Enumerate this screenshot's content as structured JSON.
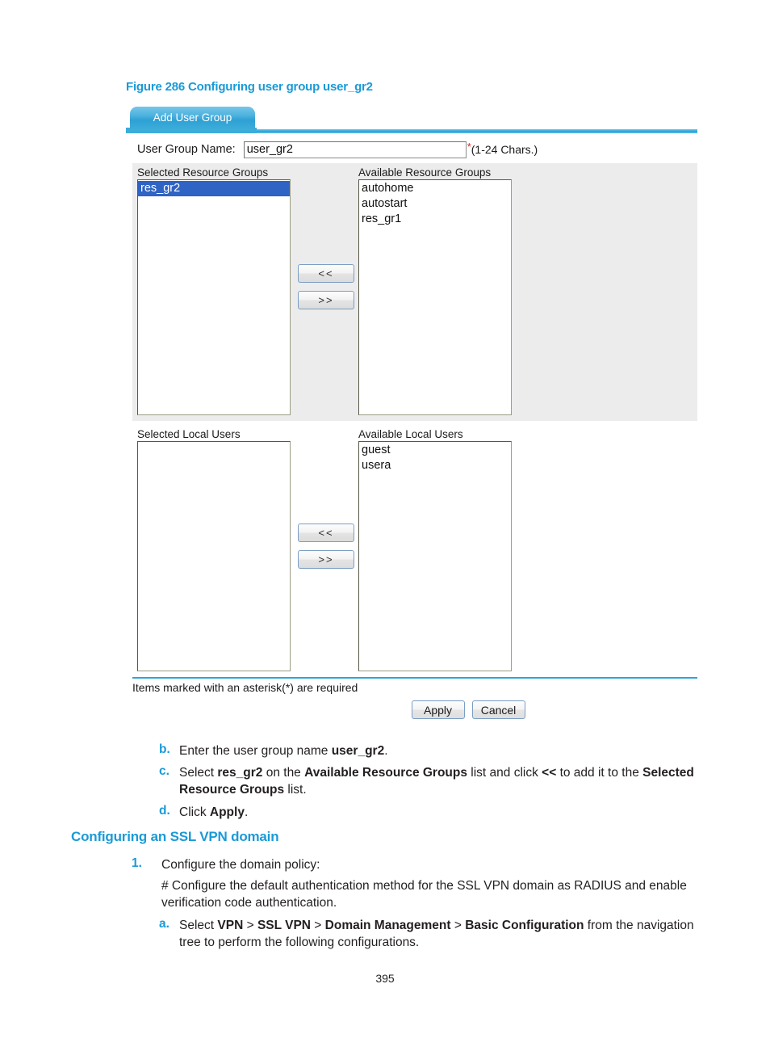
{
  "figure": {
    "caption": "Figure 286 Configuring user group user_gr2"
  },
  "dialog": {
    "tab_label": "Add User Group",
    "user_group_name": {
      "label": "User Group Name:",
      "value": "user_gr2",
      "placeholder": "",
      "required_marker": "*",
      "hint": "(1-24 Chars.)"
    },
    "resource_groups": {
      "selected_title": "Selected Resource Groups",
      "available_title": "Available Resource Groups",
      "selected_items": [
        {
          "label": "res_gr2",
          "selected": true
        }
      ],
      "available_items": [
        {
          "label": "autohome",
          "selected": false
        },
        {
          "label": "autostart",
          "selected": false
        },
        {
          "label": "res_gr1",
          "selected": false
        }
      ],
      "add_button": "<<",
      "remove_button": ">>"
    },
    "local_users": {
      "selected_title": "Selected Local Users",
      "available_title": "Available Local Users",
      "selected_items": [],
      "available_items": [
        {
          "label": "guest",
          "selected": false
        },
        {
          "label": "usera",
          "selected": false
        }
      ],
      "add_button": "<<",
      "remove_button": ">>"
    },
    "footer_note": "Items marked with an asterisk(*) are required",
    "apply_button": "Apply",
    "cancel_button": "Cancel"
  },
  "steps": {
    "b_marker": "b.",
    "b_text_1": "Enter the user group name ",
    "b_bold_1": "user_gr2",
    "b_text_2": ".",
    "c_marker": "c.",
    "c_text_1": "Select ",
    "c_bold_1": "res_gr2",
    "c_text_2": " on the ",
    "c_bold_2": "Available Resource Groups",
    "c_text_3": " list and click ",
    "c_bold_3": "<<",
    "c_text_4": " to add it to the ",
    "c_bold_4": "Selected Resource Groups",
    "c_text_5": " list.",
    "d_marker": "d.",
    "d_text_1": "Click ",
    "d_bold_1": "Apply",
    "d_text_2": "."
  },
  "section": {
    "heading": "Configuring an SSL VPN domain",
    "step1_marker": "1.",
    "step1_text": "Configure the domain policy:",
    "comment_text": "# Configure the default authentication method for the SSL VPN domain as RADIUS and enable verification code authentication.",
    "step_a_marker": "a.",
    "step_a_text_1": "Select ",
    "step_a_bold_1": "VPN",
    "step_a_sep_1": " > ",
    "step_a_bold_2": "SSL VPN",
    "step_a_sep_2": " > ",
    "step_a_bold_3": "Domain Management",
    "step_a_sep_3": " > ",
    "step_a_bold_4": "Basic Configuration",
    "step_a_text_2": " from the navigation tree to perform the following configurations."
  },
  "page": {
    "number": "395"
  },
  "colors": {
    "accent_blue": "#1a9ad7",
    "tab_blue": "#2ea0d4",
    "selection_blue": "#2f63c4",
    "required_red": "#e02020",
    "panel_gray": "#ececec"
  }
}
